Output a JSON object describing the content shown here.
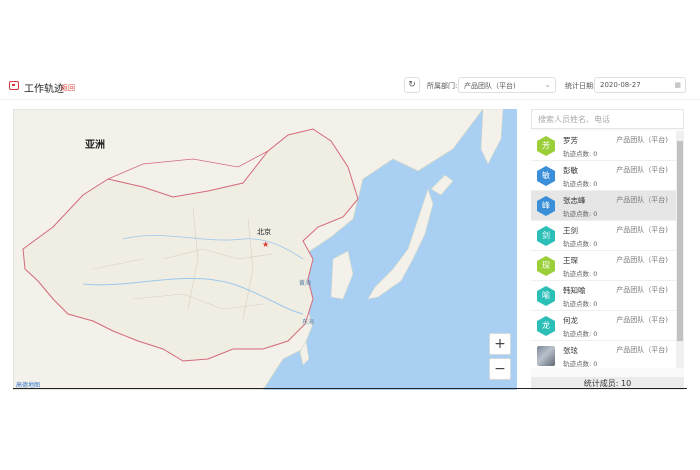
{
  "header": {
    "title": "工作轨迹",
    "back_label": "返回",
    "dept_label": "所属部门:",
    "dept_value": "产品团队（平台)",
    "date_label": "统计日期:",
    "date_value": "2020-08-27"
  },
  "map": {
    "region_label": "亚洲",
    "city_label": "北京",
    "sea_labels": [
      "黄海",
      "东海"
    ],
    "logo_text": "高德地图",
    "zoom_in": "+",
    "zoom_out": "−"
  },
  "panel": {
    "search_placeholder": "搜索人员姓名、电话",
    "people": [
      {
        "avatar": "芳",
        "name": "罗芳",
        "dept": "产品团队（平台)",
        "points": "轨迹点数: 0",
        "color": "#9bcf3a"
      },
      {
        "avatar": "敏",
        "name": "彭敏",
        "dept": "产品团队（平台)",
        "points": "轨迹点数: 0",
        "color": "#3b8fd9"
      },
      {
        "avatar": "峰",
        "name": "张志峰",
        "dept": "产品团队（平台)",
        "points": "轨迹点数: 0",
        "color": "#3b8fd9"
      },
      {
        "avatar": "剑",
        "name": "王剑",
        "dept": "产品团队（平台)",
        "points": "轨迹点数: 0",
        "color": "#2bbfb8"
      },
      {
        "avatar": "琛",
        "name": "王琛",
        "dept": "产品团队（平台)",
        "points": "轨迹点数: 0",
        "color": "#9bcf3a"
      },
      {
        "avatar": "喻",
        "name": "韩知喻",
        "dept": "产品团队（平台)",
        "points": "轨迹点数: 0",
        "color": "#2bbfb8"
      },
      {
        "avatar": "龙",
        "name": "何龙",
        "dept": "产品团队（平台)",
        "points": "轨迹点数: 0",
        "color": "#2bbfb8"
      },
      {
        "avatar": "",
        "name": "张玹",
        "dept": "产品团队（平台)",
        "points": "轨迹点数: 0",
        "color": "#8a939e"
      }
    ],
    "footer": "统计成员: 10"
  }
}
